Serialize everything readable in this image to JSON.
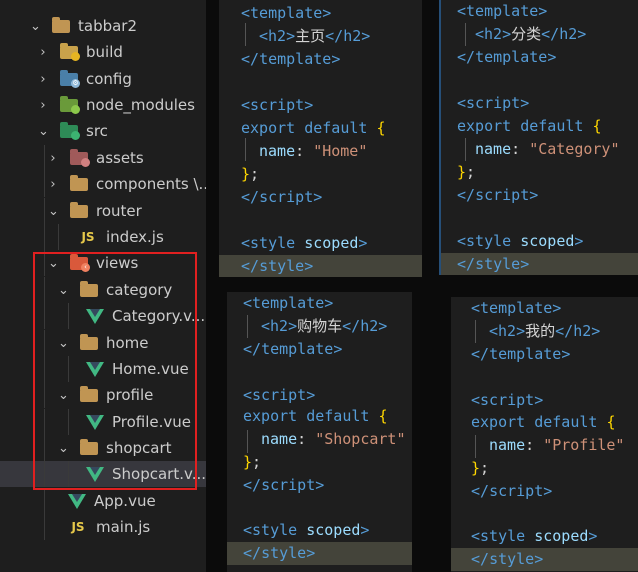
{
  "explorer": {
    "items": [
      {
        "label": "tabbar2",
        "icon": "folder-open-icon",
        "chevron": "down"
      },
      {
        "label": "build",
        "icon": "folder-build-icon",
        "chevron": "right"
      },
      {
        "label": "config",
        "icon": "folder-config-icon",
        "chevron": "right"
      },
      {
        "label": "node_modules",
        "icon": "folder-node-icon",
        "chevron": "right"
      },
      {
        "label": "src",
        "icon": "folder-src-icon",
        "chevron": "down"
      },
      {
        "label": "assets",
        "icon": "folder-assets-icon",
        "chevron": "right"
      },
      {
        "label": "components \\...",
        "icon": "folder-icon",
        "chevron": "right"
      },
      {
        "label": "router",
        "icon": "folder-open-icon",
        "chevron": "down"
      },
      {
        "label": "index.js",
        "icon": "js-icon",
        "chevron": ""
      },
      {
        "label": "views",
        "icon": "folder-views-icon",
        "chevron": "down"
      },
      {
        "label": "category",
        "icon": "folder-open-icon",
        "chevron": "down"
      },
      {
        "label": "Category.v...",
        "icon": "vue-icon",
        "chevron": ""
      },
      {
        "label": "home",
        "icon": "folder-open-icon",
        "chevron": "down"
      },
      {
        "label": "Home.vue",
        "icon": "vue-icon",
        "chevron": ""
      },
      {
        "label": "profile",
        "icon": "folder-open-icon",
        "chevron": "down"
      },
      {
        "label": "Profile.vue",
        "icon": "vue-icon",
        "chevron": ""
      },
      {
        "label": "shopcart",
        "icon": "folder-open-icon",
        "chevron": "down"
      },
      {
        "label": "Shopcart.v...",
        "icon": "vue-icon",
        "chevron": ""
      },
      {
        "label": "App.vue",
        "icon": "vue-icon",
        "chevron": ""
      },
      {
        "label": "main.js",
        "icon": "js-icon",
        "chevron": ""
      }
    ]
  },
  "panels": {
    "home": {
      "h2": "主页",
      "name": "\"Home\""
    },
    "category": {
      "h2": "分类",
      "name": "\"Category\""
    },
    "shopcart": {
      "h2": "购物车",
      "name": "\"Shopcart\""
    },
    "profile": {
      "h2": "我的",
      "name": "\"Profile\""
    },
    "common": {
      "template_open": "template",
      "template_close": "template",
      "h2": "h2",
      "script": "script",
      "export": "export",
      "default": "default",
      "name_key": "name",
      "style": "style",
      "scoped": "scoped"
    }
  },
  "colors": {
    "highlight_box": "#e02020",
    "editor_bg": "#1e1e1e",
    "selected_row": "#37373d"
  }
}
